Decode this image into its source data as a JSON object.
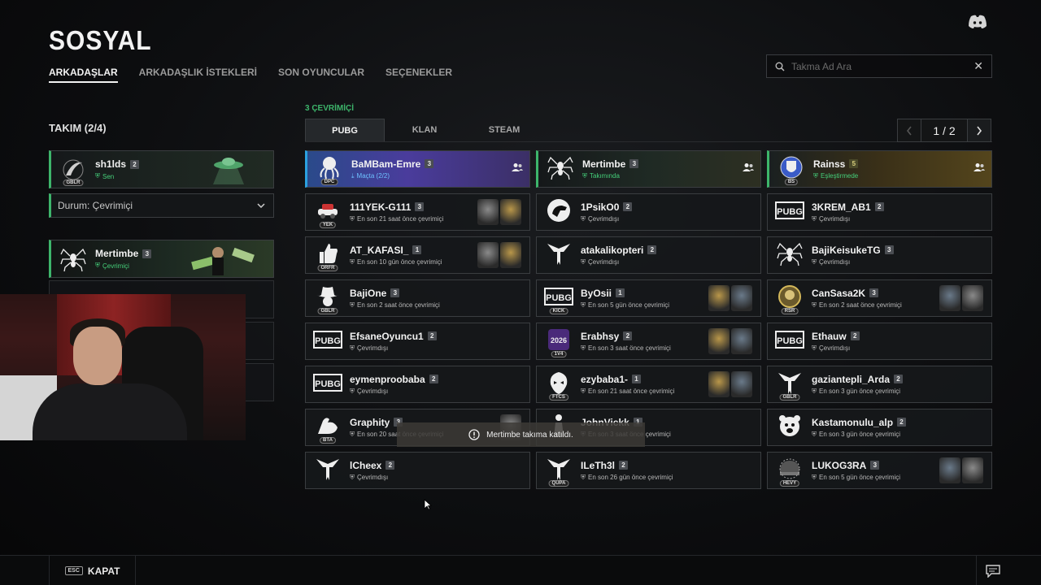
{
  "header": {
    "title": "SOSYAL"
  },
  "nav": {
    "tabs": [
      "ARKADAŞLAR",
      "ARKADAŞLIK İSTEKLERİ",
      "SON OYUNCULAR",
      "SEÇENEKLER"
    ]
  },
  "search": {
    "placeholder": "Takma Ad Ara",
    "value": ""
  },
  "team": {
    "title": "TAKIM (2/4)",
    "me": {
      "name": "sh1lds",
      "level": "2",
      "status": "Sen",
      "tag": "GBLR"
    },
    "status_dropdown": "Durum: Çevrimiçi",
    "member": {
      "name": "Mertimbe",
      "level": "3",
      "status": "Çevrimiçi"
    }
  },
  "friends": {
    "online_count": "3 ÇEVRİMİÇİ",
    "tabs": [
      "PUBG",
      "KLAN",
      "STEAM"
    ],
    "page": "1 / 2",
    "cards": [
      {
        "name": "BaMBam-Emre",
        "level": "3",
        "status": "Maçta (2/2)",
        "state": "ingame",
        "tag": "DPC",
        "icon": "octopus-icon"
      },
      {
        "name": "Mertimbe",
        "level": "3",
        "status": "Takımında",
        "state": "team",
        "tag": "",
        "icon": "spider-icon"
      },
      {
        "name": "Rainss",
        "level": "5",
        "status": "Eşleştirmede",
        "state": "match",
        "tag": "BS",
        "icon": "shield-emblem-icon"
      },
      {
        "name": "111YEK-G111",
        "level": "3",
        "status": "En son 21 saat önce çevrimiçi",
        "state": "off",
        "tag": "YEK",
        "icon": "car-emblem-icon",
        "badges": 2
      },
      {
        "name": "1PsikO0",
        "level": "2",
        "status": "Çevrimdışı",
        "state": "off",
        "tag": "",
        "icon": "dino-icon"
      },
      {
        "name": "3KREM_AB1",
        "level": "2",
        "status": "Çevrimdışı",
        "state": "off",
        "tag": "",
        "icon": "pubg-logo-icon"
      },
      {
        "name": "AT_KAFASI_",
        "level": "1",
        "status": "En son 10 gün önce çevrimiçi",
        "state": "off",
        "tag": "ORFR",
        "icon": "thumbs-up-icon",
        "badges": 2
      },
      {
        "name": "atakalikopteri",
        "level": "2",
        "status": "Çevrimdışı",
        "state": "off",
        "tag": "",
        "icon": "wings-icon"
      },
      {
        "name": "BajiKeisukeTG",
        "level": "3",
        "status": "Çevrimdışı",
        "state": "off",
        "tag": "",
        "icon": "spider-icon"
      },
      {
        "name": "BajiOne",
        "level": "3",
        "status": "En son 2 saat önce çevrimiçi",
        "state": "off",
        "tag": "GBLR",
        "icon": "cowboy-icon"
      },
      {
        "name": "ByOsii",
        "level": "1",
        "status": "En son 5 gün önce çevrimiçi",
        "state": "off",
        "tag": "KICK",
        "icon": "pubg-logo-icon",
        "badges": 2
      },
      {
        "name": "CanSasa2K",
        "level": "3",
        "status": "En son 2 saat önce çevrimiçi",
        "state": "off",
        "tag": "RSR",
        "icon": "emblem-icon",
        "badges": 2
      },
      {
        "name": "EfsaneOyuncu1",
        "level": "2",
        "status": "Çevrimdışı",
        "state": "off",
        "tag": "",
        "icon": "pubg-logo-icon"
      },
      {
        "name": "Erabhsy",
        "level": "2",
        "status": "En son 3 saat önce çevrimiçi",
        "state": "off",
        "tag": "1V4",
        "icon": "badge-2026-icon",
        "badges": 2
      },
      {
        "name": "Ethauw",
        "level": "2",
        "status": "Çevrimdışı",
        "state": "off",
        "tag": "",
        "icon": "pubg-logo-icon"
      },
      {
        "name": "eymenproobaba",
        "level": "2",
        "status": "Çevrimdışı",
        "state": "off",
        "tag": "",
        "icon": "pubg-logo-icon"
      },
      {
        "name": "ezybaba1-",
        "level": "1",
        "status": "En son 21 saat önce çevrimiçi",
        "state": "off",
        "tag": "FTCS",
        "icon": "mask-icon",
        "badges": 2
      },
      {
        "name": "gaziantepli_Arda",
        "level": "2",
        "status": "En son 3 gün önce çevrimiçi",
        "state": "off",
        "tag": "GBLR",
        "icon": "wings-icon"
      },
      {
        "name": "Graphity",
        "level": "3",
        "status": "En son 20 saat önce çevrimiçi",
        "state": "off",
        "tag": "BTA",
        "icon": "flex-arm-icon",
        "badges": 1
      },
      {
        "name": "JohnVickk",
        "level": "1",
        "status": "En son 3 saat önce çevrimiçi",
        "state": "off",
        "tag": "",
        "icon": "figure-icon"
      },
      {
        "name": "Kastamonulu_alp",
        "level": "2",
        "status": "En son 3 gün önce çevrimiçi",
        "state": "off",
        "tag": "",
        "icon": "bear-icon"
      },
      {
        "name": "lCheex",
        "level": "2",
        "status": "Çevrimdışı",
        "state": "off",
        "tag": "",
        "icon": "wings-icon"
      },
      {
        "name": "ILeTh3l",
        "level": "2",
        "status": "En son 26 gün önce çevrimiçi",
        "state": "off",
        "tag": "QUPA",
        "icon": "wings-icon"
      },
      {
        "name": "LUKOG3RA",
        "level": "3",
        "status": "En son 5 gün önce çevrimiçi",
        "state": "off",
        "tag": "HEVY",
        "icon": "helmet-icon",
        "badges": 2
      }
    ]
  },
  "toast": {
    "message": "Mertimbe takıma katıldı."
  },
  "footer": {
    "esc_key": "ESC",
    "close_label": "KAPAT"
  },
  "colors": {
    "online_green": "#3db56b",
    "ingame_blue": "#2ba1e0"
  }
}
